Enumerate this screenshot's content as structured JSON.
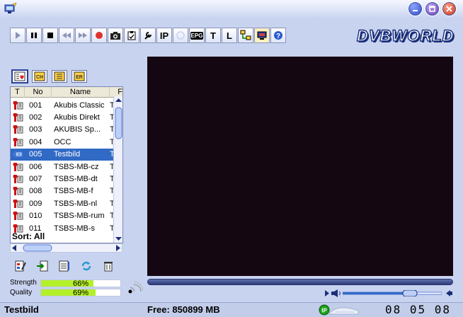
{
  "toolbar": {
    "ip_label": "IP",
    "epg_label": "EPG",
    "t_label": "T",
    "l_label": "L"
  },
  "brand": {
    "logo_text": "DVBWORLD"
  },
  "channel_list": {
    "columns": {
      "type": "T",
      "number": "No",
      "name": "Name",
      "extra": "F"
    },
    "rows": [
      {
        "no": "001",
        "name": "Akubis Classic",
        "t": "T-S",
        "type": "tv"
      },
      {
        "no": "002",
        "name": "Akubis Direkt",
        "t": "T-S",
        "type": "tv"
      },
      {
        "no": "003",
        "name": "AKUBIS Sp...",
        "t": "T-S",
        "type": "tv"
      },
      {
        "no": "004",
        "name": "OCC",
        "t": "T-S",
        "type": "tv"
      },
      {
        "no": "005",
        "name": "Testbild",
        "t": "T-S",
        "type": "radio"
      },
      {
        "no": "006",
        "name": "TSBS-MB-cz",
        "t": "T-S",
        "type": "tv"
      },
      {
        "no": "007",
        "name": "TSBS-MB-dt",
        "t": "T-S",
        "type": "tv"
      },
      {
        "no": "008",
        "name": "TSBS-MB-f",
        "t": "T-S",
        "type": "tv"
      },
      {
        "no": "009",
        "name": "TSBS-MB-nl",
        "t": "T-S",
        "type": "tv"
      },
      {
        "no": "010",
        "name": "TSBS-MB-rum",
        "t": "T-S",
        "type": "tv"
      },
      {
        "no": "011",
        "name": "TSBS-MB-s",
        "t": "T-S",
        "type": "tv"
      }
    ],
    "selected_index": 4,
    "sort_label": "Sort: All"
  },
  "signal": {
    "strength_label": "Strength",
    "strength_value": 66,
    "strength_text": "66%",
    "quality_label": "Quality",
    "quality_value": 69,
    "quality_text": "69%"
  },
  "volume": {
    "level": 0.75
  },
  "status": {
    "channel_name": "Testbild",
    "free_space": "Free: 850899 MB",
    "clock": "08 05 08"
  },
  "colors": {
    "accent": "#316ac5",
    "signal_fill": "#b4f02a",
    "video_bg": "#150711"
  }
}
